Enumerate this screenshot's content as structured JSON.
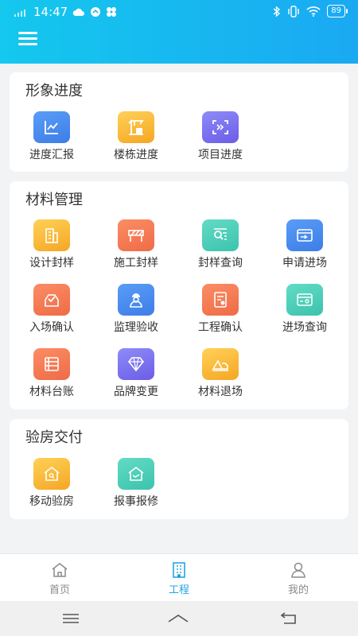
{
  "status": {
    "time": "14:47",
    "battery": "89"
  },
  "sections": [
    {
      "title": "形象进度",
      "items": [
        {
          "label": "进度汇报",
          "icon": "chart-icon",
          "color": "#4a8cf0"
        },
        {
          "label": "楼栋进度",
          "icon": "crane-icon",
          "color": "#f8b93a"
        },
        {
          "label": "项目进度",
          "icon": "scan-icon",
          "color": "#7b72f0"
        }
      ]
    },
    {
      "title": "材料管理",
      "items": [
        {
          "label": "设计封样",
          "icon": "building-icon",
          "color": "#f8b93a"
        },
        {
          "label": "施工封样",
          "icon": "barrier-icon",
          "color": "#f27a55"
        },
        {
          "label": "封样查询",
          "icon": "search-list-icon",
          "color": "#4fcfb8"
        },
        {
          "label": "申请进场",
          "icon": "card-transfer-icon",
          "color": "#4a8cf0"
        },
        {
          "label": "入场确认",
          "icon": "inbox-check-icon",
          "color": "#f27a55"
        },
        {
          "label": "监理验收",
          "icon": "supervisor-icon",
          "color": "#4a8cf0"
        },
        {
          "label": "工程确认",
          "icon": "document-check-icon",
          "color": "#f27a55"
        },
        {
          "label": "进场查询",
          "icon": "card-search-icon",
          "color": "#4fcfb8"
        },
        {
          "label": "材料台账",
          "icon": "ledger-icon",
          "color": "#f27a55"
        },
        {
          "label": "品牌变更",
          "icon": "diamond-icon",
          "color": "#7b72f0"
        },
        {
          "label": "材料退场",
          "icon": "truck-icon",
          "color": "#f8b93a"
        }
      ]
    },
    {
      "title": "验房交付",
      "items": [
        {
          "label": "移动验房",
          "icon": "house-search-icon",
          "color": "#f8b93a"
        },
        {
          "label": "报事报修",
          "icon": "house-repair-icon",
          "color": "#4fcfb8"
        }
      ]
    }
  ],
  "tabs": [
    {
      "label": "首页",
      "icon": "home-icon",
      "active": false
    },
    {
      "label": "工程",
      "icon": "building-tab-icon",
      "active": true
    },
    {
      "label": "我的",
      "icon": "user-icon",
      "active": false
    }
  ],
  "colors": {
    "header_start": "#14c8ee",
    "header_end": "#1aa9f2",
    "active_tab": "#1fa7e6"
  }
}
